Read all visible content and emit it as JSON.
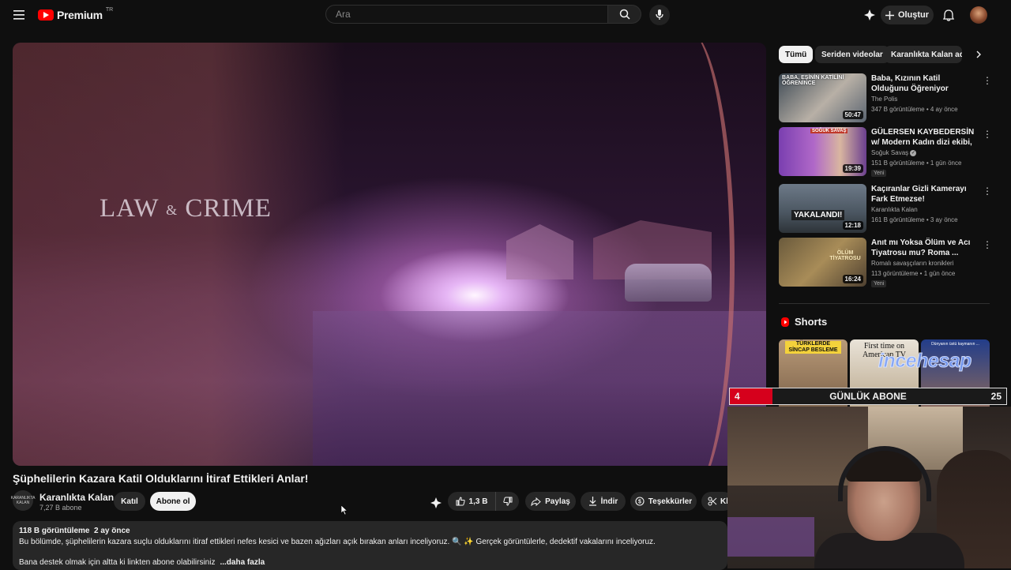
{
  "header": {
    "logo_text": "Premium",
    "logo_region": "TR",
    "search_placeholder": "Ara",
    "create_label": "Oluştur"
  },
  "player": {
    "watermark_left": "LAW",
    "watermark_amp": "&",
    "watermark_right": "CRIME"
  },
  "video": {
    "title": "Şüphelilerin Kazara Katil Olduklarını İtiraf Ettikleri Anlar!",
    "channel_name": "Karanlıkta Kalan",
    "channel_avatar_text": "KARANLIKTA KALAN",
    "subscribers": "7,27 B abone",
    "join_label": "Katıl",
    "subscribe_label": "Abone ol",
    "like_count": "1,3 B",
    "share_label": "Paylaş",
    "download_label": "İndir",
    "thanks_label": "Teşekkürler",
    "clip_label": "Kl"
  },
  "description": {
    "views": "118 B görüntüleme",
    "age": "2 ay önce",
    "line1": "Bu bölümde, şüphelilerin kazara suçlu olduklarını itiraf ettikleri nefes kesici ve bazen ağızları açık bırakan anları inceliyoruz. 🔍 ✨ Gerçek görüntülerle, dedektif vakalarını inceliyoruz.",
    "line2": "Bana destek olmak için altta ki linkten abone olabilirsiniz",
    "line2_fade": "",
    "more": "...daha fazla"
  },
  "chips": [
    "Tümü",
    "Seriden videolar",
    "Karanlıkta Kalan adlı"
  ],
  "recommendations": [
    {
      "title": "Baba, Kızının Katil Olduğunu Öğreniyor",
      "channel": "The Polis",
      "verified": false,
      "meta": "347 B görüntüleme • 4 ay önce",
      "duration": "50:47",
      "badge": "",
      "thumb_text": "BABA, EŞİNİN KATİLİNİ ÖĞRENİNCE"
    },
    {
      "title": "GÜLERSEN KAYBEDERSİN w/ Modern Kadın dizi ekibi, İrem ...",
      "channel": "Soğuk Savaş",
      "verified": true,
      "meta": "151 B görüntüleme • 1 gün önce",
      "duration": "19:39",
      "badge": "Yeni",
      "thumb_text": "SOĞUK SAVAŞ"
    },
    {
      "title": "Kaçıranlar Gizli Kamerayı Fark Etmezse!",
      "channel": "Karanlıkta Kalan",
      "verified": false,
      "meta": "161 B görüntüleme • 3 ay önce",
      "duration": "12:18",
      "badge": "",
      "thumb_text": "YAKALANDI!"
    },
    {
      "title": "Anıt mı Yoksa Ölüm ve Acı Tiyatrosu mu? Roma ...",
      "channel": "Romalı savaşçıların kronikleri",
      "verified": false,
      "meta": "113 görüntüleme • 1 gün önce",
      "duration": "16:24",
      "badge": "Yeni",
      "thumb_text": "ÖLÜM TİYATROSU"
    }
  ],
  "shorts": {
    "heading": "Shorts",
    "items": [
      {
        "thumb_text": "TÜRKLERDE SİNCAP BESLEME"
      },
      {
        "thumb_text": "First time on American TV"
      },
      {
        "thumb_text": "Dünyanın üstü kaymanın ..."
      }
    ]
  },
  "overlay": {
    "sub_current": "4",
    "sub_label": "GÜNLÜK ABONE",
    "sub_goal": "25",
    "sponsor": "incehesap"
  },
  "colors": {
    "brand": "#ff0000",
    "background": "#0f0f0f",
    "chip_bg": "#272727",
    "sub_bar": "#d6001c"
  }
}
